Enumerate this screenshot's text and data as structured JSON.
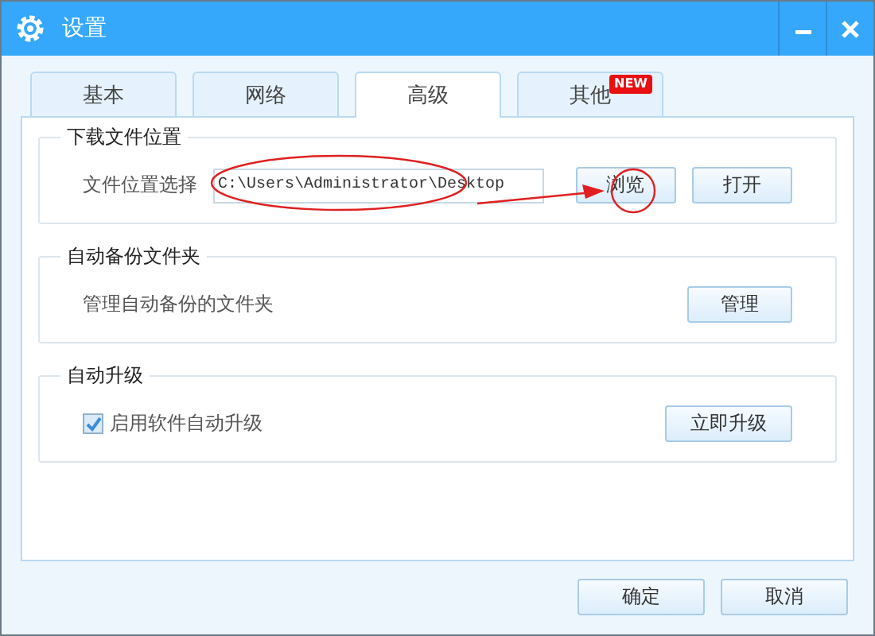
{
  "window": {
    "title": "设置"
  },
  "tabs": [
    {
      "label": "基本",
      "selected": false
    },
    {
      "label": "网络",
      "selected": false
    },
    {
      "label": "高级",
      "selected": true
    },
    {
      "label": "其他",
      "selected": false,
      "badge": "NEW"
    }
  ],
  "groups": [
    {
      "kind": "path",
      "title": "下载文件位置",
      "label": "文件位置选择",
      "value": "C:\\Users\\Administrator\\Desktop",
      "buttons": [
        "浏览",
        "打开"
      ]
    },
    {
      "kind": "text",
      "title": "自动备份文件夹",
      "label": "管理自动备份的文件夹",
      "buttons": [
        "管理"
      ]
    },
    {
      "kind": "checkbox",
      "title": "自动升级",
      "label": "启用软件自动升级",
      "checked": true,
      "buttons": [
        "立即升级"
      ]
    }
  ],
  "buttons": [
    "确定",
    "取消"
  ]
}
